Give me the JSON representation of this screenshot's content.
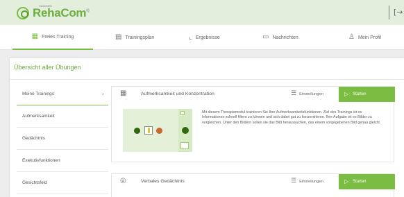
{
  "app": {
    "brand": "RehaCom",
    "brand_mark": "®",
    "brand_tagline": "HASOMED"
  },
  "nav": {
    "tabs": [
      {
        "label": "Freies Training",
        "icon": "grid-icon",
        "active": true
      },
      {
        "label": "Trainingsplan",
        "icon": "calendar-icon",
        "active": false
      },
      {
        "label": "Ergebnisse",
        "icon": "chart-icon",
        "active": false
      },
      {
        "label": "Nachrichten",
        "icon": "message-icon",
        "active": false
      },
      {
        "label": "Mein Profil",
        "icon": "user-icon",
        "active": false
      }
    ]
  },
  "overview": {
    "title": "Übersicht aller Übungen"
  },
  "sidebar": {
    "items": [
      {
        "label": "Meine Trainings",
        "active": true
      },
      {
        "label": "Aufmerksamkeit"
      },
      {
        "label": "Gedächtnis"
      },
      {
        "label": "Exekutivfunktionen"
      },
      {
        "label": "Gesichtsfeld"
      }
    ]
  },
  "cards": [
    {
      "title": "Aufmerksamkeit und Konzentration",
      "icon": "grid-icon",
      "settings_label": "Einstellungen",
      "start_label": "Starten",
      "description": "Mit diesem Therapiemodul trainieren Sie Ihre Aufmerksamkeitsfunktionen. Ziel des Trainings ist es Informationen schnell filtern zu können und sich dabei gut zu konzentrieren. Ihre Aufgabe ist es Bilder zu vergleichen. Unter den Bildern sollen sie das Bild heraussuchen, das einem vorgegebenen Bild genau gleicht."
    },
    {
      "title": "Verbales Gedächtnis",
      "icon": "speech-icon",
      "settings_label": "Einstellungen",
      "start_label": "Starten"
    }
  ],
  "colors": {
    "accent": "#7bbd42",
    "header_bg": "#e3eedd",
    "page_bg": "#ededed"
  }
}
